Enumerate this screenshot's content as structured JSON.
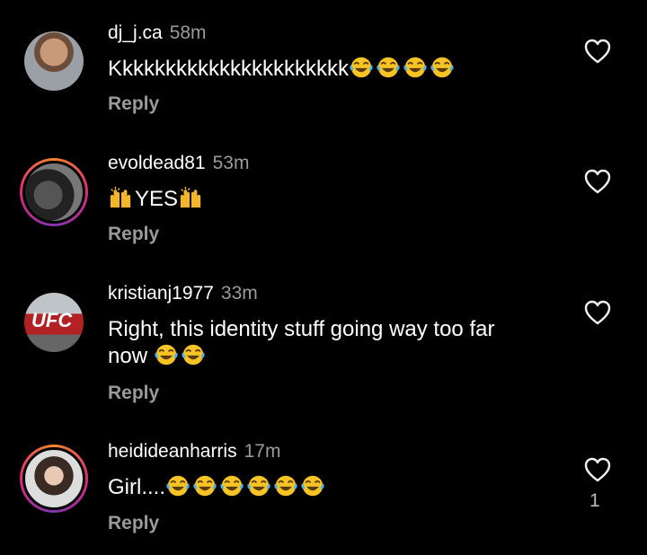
{
  "comments": [
    {
      "username": "dj_j.ca",
      "time": "58m",
      "text": "Kkkkkkkkkkkkkkkkkkkkkk",
      "emojis": [
        "joy-emoji",
        "joy-emoji",
        "joy-emoji",
        "joy-emoji"
      ],
      "reply": "Reply",
      "likes": ""
    },
    {
      "username": "evoldead81",
      "time": "53m",
      "text": "YES",
      "reply": "Reply",
      "likes": ""
    },
    {
      "username": "kristianj1977",
      "time": "33m",
      "text_line1": "Right, this identity stuff going way too far",
      "text_line2": "now",
      "reply": "Reply",
      "likes": ""
    },
    {
      "username": "heidideanharris",
      "time": "17m",
      "text": "Girl....",
      "reply": "Reply",
      "likes": "1"
    }
  ],
  "icons": {
    "heart": "heart-outline-icon",
    "emoji_joy": "face-with-tears-of-joy",
    "emoji_hands": "raising-hands"
  },
  "colors": {
    "background": "#000000",
    "text": "#ffffff",
    "secondary": "#9a9a9a",
    "ring_start": "#f58529",
    "ring_end": "#dd2a7b"
  }
}
